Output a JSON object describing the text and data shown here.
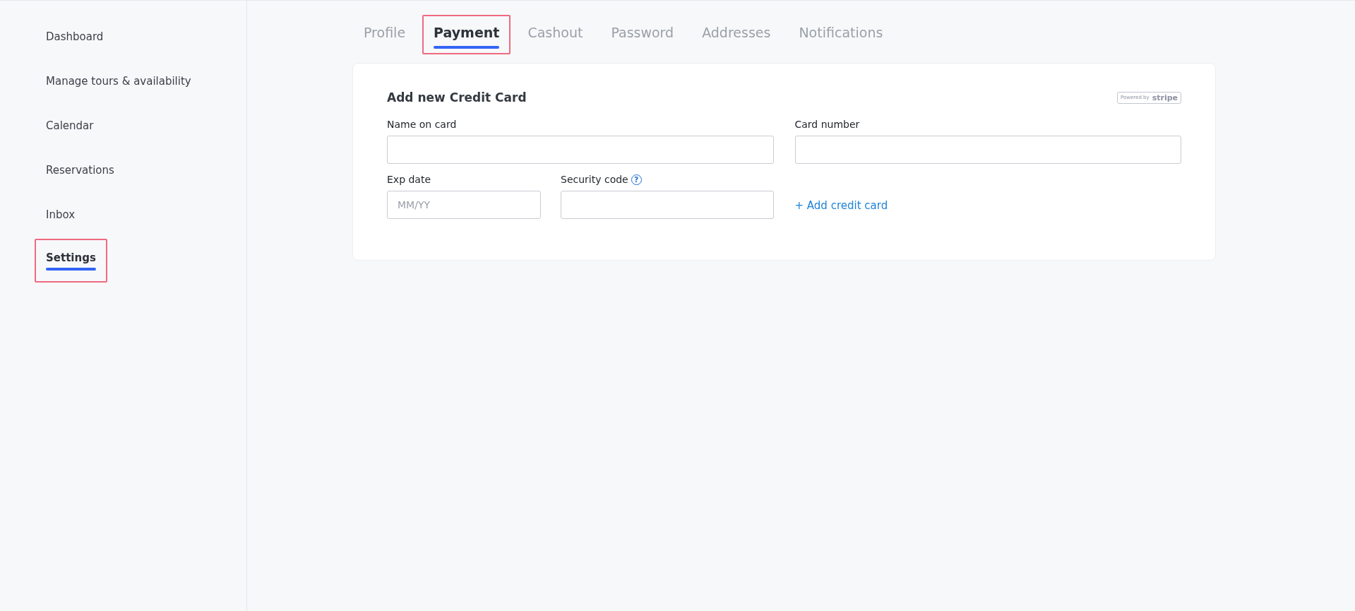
{
  "sidebar": {
    "items": [
      {
        "label": "Dashboard",
        "selected": false,
        "highlighted": false
      },
      {
        "label": "Manage tours & availability",
        "selected": false,
        "highlighted": false
      },
      {
        "label": "Calendar",
        "selected": false,
        "highlighted": false
      },
      {
        "label": "Reservations",
        "selected": false,
        "highlighted": false
      },
      {
        "label": "Inbox",
        "selected": false,
        "highlighted": false
      },
      {
        "label": "Settings",
        "selected": true,
        "highlighted": true
      }
    ]
  },
  "tabs": [
    {
      "label": "Profile",
      "selected": false,
      "highlighted": false
    },
    {
      "label": "Payment",
      "selected": true,
      "highlighted": true
    },
    {
      "label": "Cashout",
      "selected": false,
      "highlighted": false
    },
    {
      "label": "Password",
      "selected": false,
      "highlighted": false
    },
    {
      "label": "Addresses",
      "selected": false,
      "highlighted": false
    },
    {
      "label": "Notifications",
      "selected": false,
      "highlighted": false
    }
  ],
  "card": {
    "title": "Add new Credit Card",
    "badge": {
      "prefix": "Powered by",
      "brand": "stripe"
    },
    "name_field": {
      "label": "Name on card"
    },
    "number_field": {
      "label": "Card number"
    },
    "exp_field": {
      "label": "Exp date",
      "placeholder": "MM/YY"
    },
    "security_field": {
      "label": "Security code",
      "help": "?"
    },
    "add_link": "+ Add credit card"
  }
}
